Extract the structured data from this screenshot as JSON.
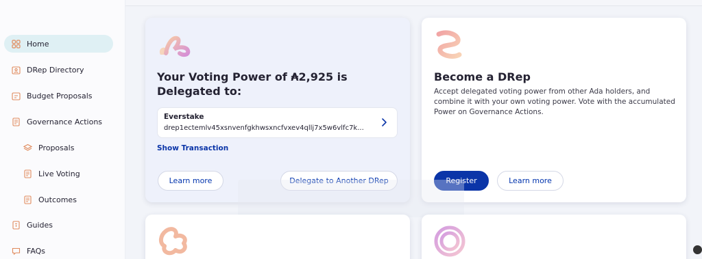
{
  "sidebar": {
    "items": [
      {
        "label": "Home",
        "icon": "dashboard-grid-icon",
        "active": true
      },
      {
        "label": "DRep Directory",
        "icon": "directory-icon"
      },
      {
        "label": "Budget Proposals",
        "icon": "budget-icon"
      },
      {
        "label": "Governance Actions",
        "icon": "document-icon"
      },
      {
        "label": "Proposals",
        "icon": "layers-icon"
      },
      {
        "label": "Live Voting",
        "icon": "document-icon"
      },
      {
        "label": "Outcomes",
        "icon": "document-icon"
      },
      {
        "label": "Guides",
        "icon": "book-icon"
      },
      {
        "label": "FAQs",
        "icon": "chat-icon"
      }
    ]
  },
  "voting_card": {
    "title_prefix": "Your Voting Power of ",
    "amount": "₳2,925",
    "title_suffix": " is Delegated to:",
    "drep_name": "Everstake",
    "drep_id": "drep1ectemlv45xsnvenfgkhwsxncfvxev4qllj7x5w6vlfc7k...",
    "show_transaction": "Show Transaction",
    "learn_more": "Learn more",
    "delegate_another": "Delegate to Another DRep"
  },
  "drep_card": {
    "title": "Become a DRep",
    "description": "Accept delegated voting power from other Ada holders, and combine it with your own voting power. Vote with the accumulated Power on Governance Actions.",
    "register": "Register",
    "learn_more": "Learn more"
  },
  "colors": {
    "primary": "#0b35a8",
    "active_nav": "#dff0f4",
    "page_bg": "#f2f4f9"
  }
}
